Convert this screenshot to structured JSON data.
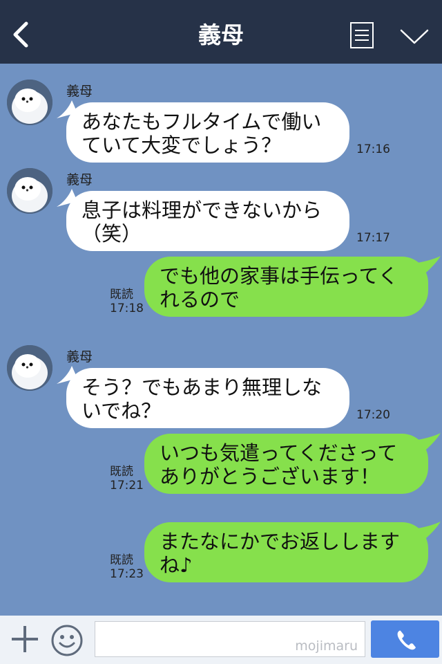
{
  "header": {
    "title": "義母"
  },
  "messages": [
    {
      "sender": "義母",
      "lines": [
        "あなたもフルタイムで働い",
        "ていて大変でしょう？"
      ],
      "time": "17:16"
    },
    {
      "sender": "義母",
      "lines": [
        "息子は料理ができないから",
        "（笑）"
      ],
      "time": "17:17"
    },
    {
      "lines": [
        "でも他の家事は手伝ってく",
        "れるので"
      ],
      "read": "既読",
      "time": "17:18"
    },
    {
      "sender": "義母",
      "lines": [
        "そう？でもあまり無理しな",
        "いでね？"
      ],
      "time": "17:20"
    },
    {
      "lines": [
        "いつも気遣ってくださって",
        "ありがとうございます！"
      ],
      "read": "既読",
      "time": "17:21"
    },
    {
      "lines": [
        "またなにかでお返しします",
        "ね♪"
      ],
      "read": "既読",
      "time": "17:23"
    }
  ],
  "footer": {
    "watermark": "mojimaru"
  },
  "colors": {
    "header": "#263248",
    "background": "#7092c2",
    "outgoing": "#86e04c",
    "incoming": "#ffffff",
    "send": "#4d84e2"
  },
  "icons": {
    "back": "chevron-left-icon",
    "menu": "list-icon",
    "collapse": "chevron-down-icon",
    "add": "plus-icon",
    "sticker": "smiley-icon",
    "send": "phone-icon"
  }
}
